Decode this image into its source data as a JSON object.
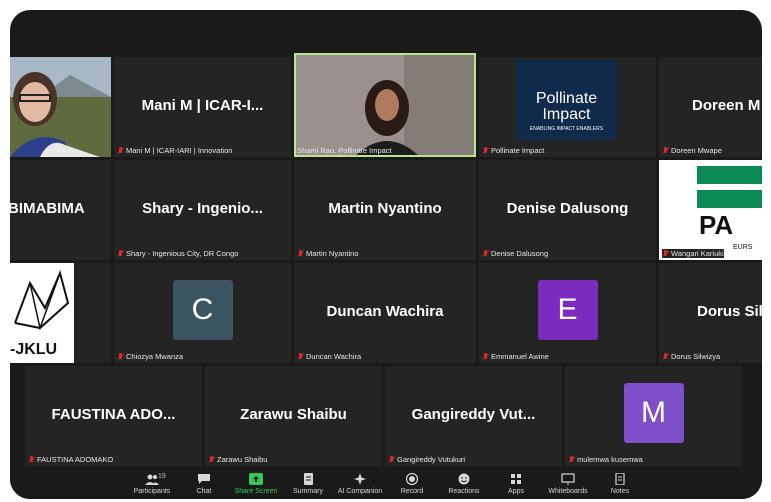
{
  "tiles": [
    {
      "label": "",
      "big": ""
    },
    {
      "label": "Mani M | ICAR-IARI | Innovation",
      "big": "Mani M | ICAR-I..."
    },
    {
      "label": "Shami Rao, Pollinate Impact",
      "big": ""
    },
    {
      "label": "Pollinate Impact",
      "big": ""
    },
    {
      "label": "Doreen Mwape",
      "big": "Doreen M"
    },
    {
      "label": "",
      "big": "BIMABIMA"
    },
    {
      "label": "Shary - Ingenious City, DR Congo",
      "big": "Shary - Ingenio..."
    },
    {
      "label": "Martin Nyantino",
      "big": "Martin Nyantino"
    },
    {
      "label": "Denise Dalusong",
      "big": "Denise Dalusong"
    },
    {
      "label": "Wangari Kariuki",
      "big": ""
    },
    {
      "label": "",
      "big": ""
    },
    {
      "label": "Chiozya Mwanza",
      "big": ""
    },
    {
      "label": "Duncan Wachira",
      "big": "Duncan Wachira"
    },
    {
      "label": "Emmanuel Awine",
      "big": ""
    },
    {
      "label": "Dorus Silwizya",
      "big": "Dorus Silv"
    },
    {
      "label": "FAUSTINA ADOMAKO",
      "big": "FAUSTINA ADO..."
    },
    {
      "label": "Zarawu Shaibu",
      "big": "Zarawu Shaibu"
    },
    {
      "label": "Gangireddy Vutukuri",
      "big": "Gangireddy Vut..."
    },
    {
      "label": "mulemwa kusemwa",
      "big": ""
    }
  ],
  "avatars": {
    "c": "C",
    "e": "E",
    "m": "M"
  },
  "logo": {
    "line1": "Pollinate",
    "line2": "Impact",
    "tag": "ENABLING IMPACT ENABLERS",
    "partial1": "-JKLU",
    "partial2": "PA",
    "partial3": "EURS"
  },
  "toolbar": {
    "participants": "Participants",
    "count": "19",
    "chat": "Chat",
    "share": "Share Screen",
    "summary": "Summary",
    "ai": "AI Companion",
    "record": "Record",
    "reactions": "Reactions",
    "apps": "Apps",
    "whiteboards": "Whiteboards",
    "notes": "Notes"
  },
  "colors": {
    "active": "#b9e58f",
    "avatar_c": "#3a5461",
    "avatar_e": "#7b2cbf",
    "avatar_m": "#7f4ec9",
    "share_green": "#32c85a"
  }
}
